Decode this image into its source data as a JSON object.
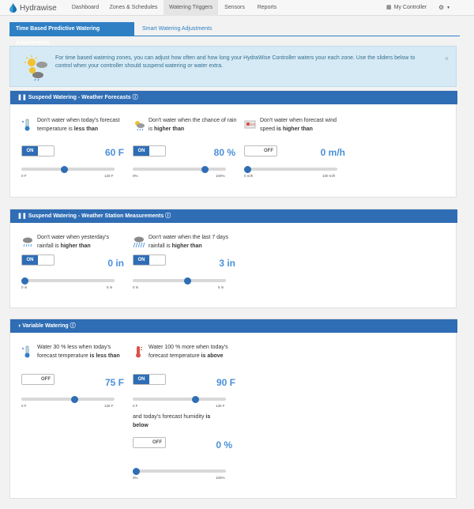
{
  "nav": {
    "brand": "Hydrawise",
    "items": [
      "Dashboard",
      "Zones & Schedules",
      "Watering Triggers",
      "Sensors",
      "Reports"
    ],
    "right": "My Controller"
  },
  "tabs": [
    "Time Based Predictive Watering Adjustments",
    "Smart Watering Adjustments"
  ],
  "info": {
    "text": "For time based watering zones, you can adjust how often and how long your HydraWise Controller waters your each zone. Use the sliders below to control when your controller should suspend watering or water extra.",
    "close": "×"
  },
  "panels": {
    "forecast": {
      "title": "Suspend Watering - Weather Forecasts",
      "temp": {
        "pre": "Don't water when today's forecast temperature is ",
        "bold": "less than",
        "toggle": "ON",
        "value": "60 F",
        "min": "0 F",
        "max": "130 F",
        "level": 0.46
      },
      "rain": {
        "pre": "Don't water when the chance of rain is ",
        "bold": "higher than",
        "toggle": "ON",
        "value": "80 %",
        "min": "0%",
        "max": "100%",
        "level": 0.8
      },
      "wind": {
        "pre": "Don't water when forecast wind speed ",
        "bold": "is higher than",
        "toggle": "OFF",
        "value": "0 m/h",
        "min": "0 m/h",
        "max": "100 m/h",
        "level": 0.0
      }
    },
    "station": {
      "title": "Suspend Watering - Weather Station Measurements",
      "yesterday": {
        "pre": "Don't water when yesterday's rainfall is ",
        "bold": "higher than",
        "toggle": "ON",
        "value": "0 in",
        "min": "0 in",
        "max": "5 in",
        "level": 0.0
      },
      "week": {
        "pre": "Don't water when the last 7 days rainfall is ",
        "bold": "higher than",
        "toggle": "ON",
        "value": "3 in",
        "min": "0 in",
        "max": "5 in",
        "level": 0.6
      }
    },
    "variable": {
      "title": "Variable Watering",
      "less": {
        "pre": "Water 30   % less when today's forecast temperature ",
        "bold": "is less than",
        "toggle": "OFF",
        "value": "75 F",
        "min": "0 F",
        "max": "130 F",
        "level": 0.58
      },
      "more": {
        "pre": "Water 100   % more when today's forecast temperature ",
        "bold": "is above",
        "toggle": "ON",
        "value": "90 F",
        "min": "0 F",
        "max": "130 F",
        "level": 0.69
      },
      "humidity": {
        "pre": "and today's forecast humidity ",
        "bold": "is below",
        "toggle": "OFF",
        "value": "0 %",
        "min": "0%",
        "max": "100%",
        "level": 0.0
      }
    }
  }
}
